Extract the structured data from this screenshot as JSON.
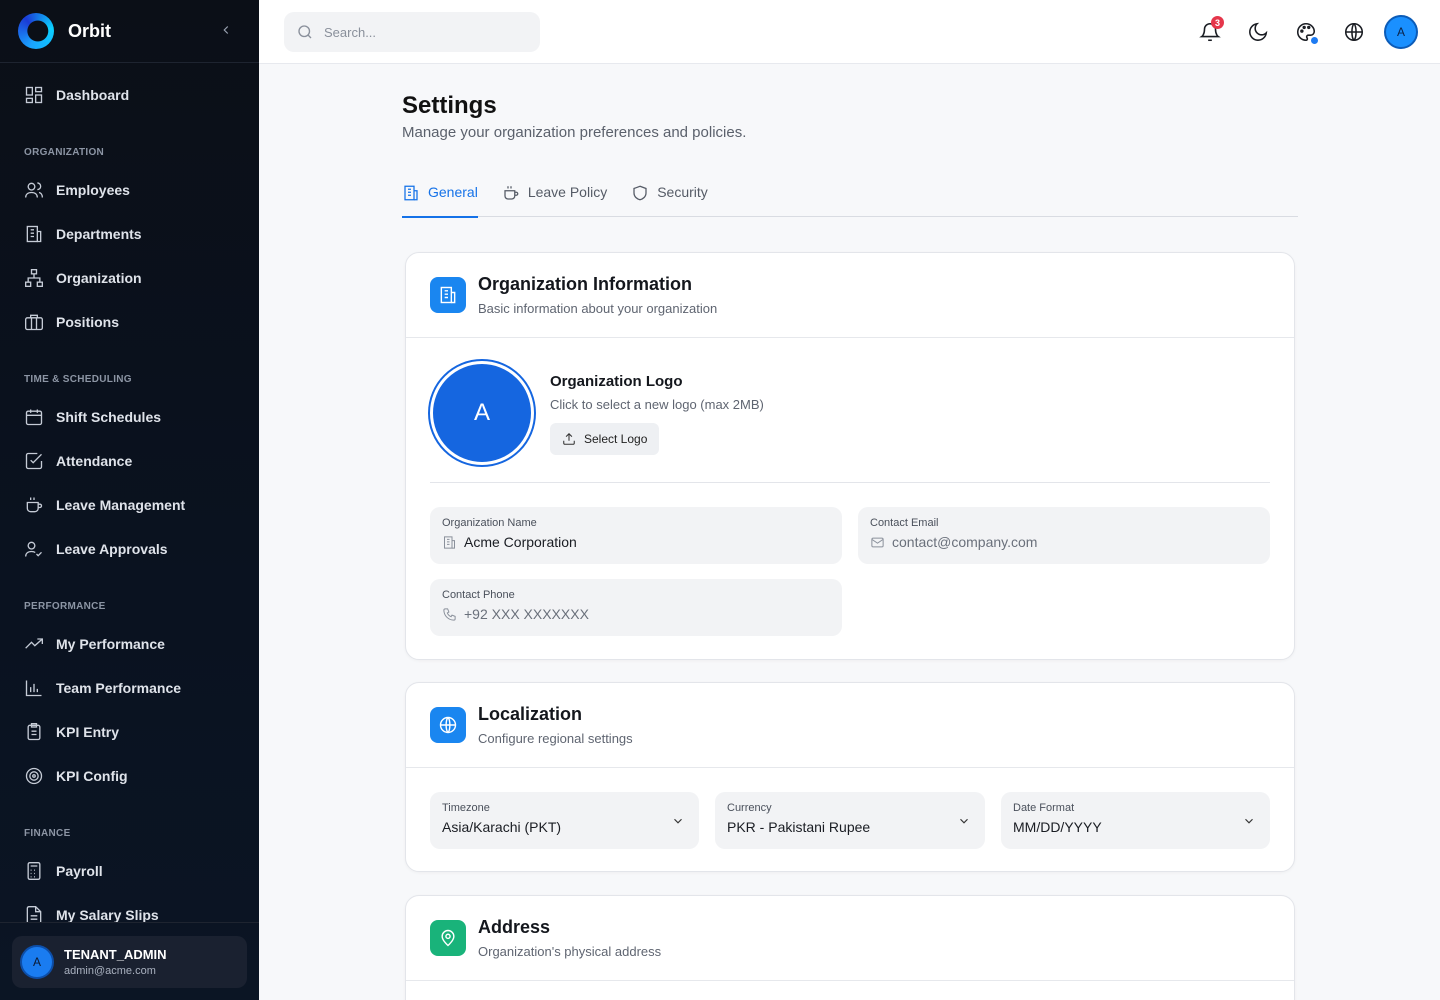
{
  "brand": {
    "name": "Orbit"
  },
  "sidebar": {
    "dashboard": "Dashboard",
    "sections": [
      {
        "title": "ORGANIZATION",
        "items": [
          "Employees",
          "Departments",
          "Organization",
          "Positions"
        ]
      },
      {
        "title": "TIME & SCHEDULING",
        "items": [
          "Shift Schedules",
          "Attendance",
          "Leave Management",
          "Leave Approvals"
        ]
      },
      {
        "title": "PERFORMANCE",
        "items": [
          "My Performance",
          "Team Performance",
          "KPI Entry",
          "KPI Config"
        ]
      },
      {
        "title": "FINANCE",
        "items": [
          "Payroll",
          "My Salary Slips"
        ]
      }
    ],
    "user": {
      "initial": "A",
      "role": "TENANT_ADMIN",
      "email": "admin@acme.com"
    }
  },
  "topbar": {
    "search_placeholder": "Search...",
    "notification_count": "3",
    "avatar_initial": "A"
  },
  "page": {
    "title": "Settings",
    "subtitle": "Manage your organization preferences and policies.",
    "tabs": [
      "General",
      "Leave Policy",
      "Security"
    ]
  },
  "org_info": {
    "title": "Organization Information",
    "subtitle": "Basic information about your organization",
    "logo_initial": "A",
    "logo_title": "Organization Logo",
    "logo_sub": "Click to select a new logo (max 2MB)",
    "select_logo": "Select Logo",
    "name_label": "Organization Name",
    "name_value": "Acme Corporation",
    "email_label": "Contact Email",
    "email_placeholder": "contact@company.com",
    "phone_label": "Contact Phone",
    "phone_placeholder": "+92 XXX XXXXXXX"
  },
  "localization": {
    "title": "Localization",
    "subtitle": "Configure regional settings",
    "timezone_label": "Timezone",
    "timezone_value": "Asia/Karachi (PKT)",
    "currency_label": "Currency",
    "currency_value": "PKR - Pakistani Rupee",
    "date_label": "Date Format",
    "date_value": "MM/DD/YYYY"
  },
  "address": {
    "title": "Address",
    "subtitle": "Organization's physical address"
  },
  "colors": {
    "accent": "#1572e8",
    "sidebar_bg": "#0b0f17",
    "address_icon": "#19b37a",
    "badge": "#e5364b"
  }
}
